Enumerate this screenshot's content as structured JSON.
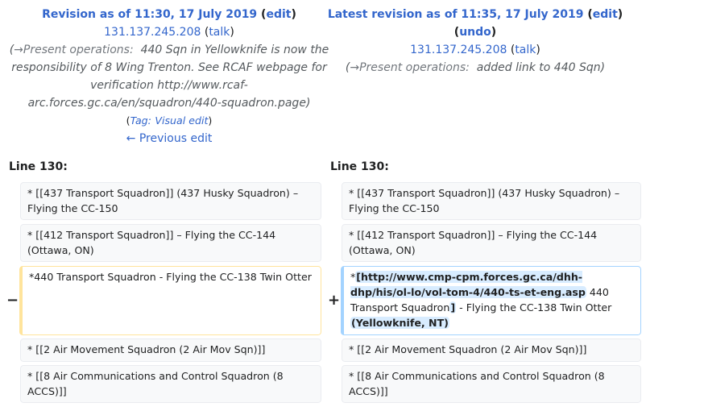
{
  "left_header": {
    "title_prefix": "Revision as of 11:30, 17 July 2019",
    "edit_link": "edit",
    "user_ip": "131.137.245.208",
    "talk_link": "talk",
    "autocomment": "→Present operations:",
    "summary": "440 Sqn in Yellowknife is now the responsibility of 8 Wing Trenton. See RCAF webpage for verification http://www.rcaf-arc.forces.gc.ca/en/squadron/440-squadron.page",
    "tag_label": "Tag:",
    "tag_value": "Visual edit",
    "prev_edit": "← Previous edit"
  },
  "right_header": {
    "title_prefix": "Latest revision as of 11:35, 17 July 2019",
    "edit_link": "edit",
    "undo_link": "undo",
    "user_ip": "131.137.245.208",
    "talk_link": "talk",
    "autocomment": "→Present operations:",
    "summary": "added link to 440 Sqn"
  },
  "line_labels": {
    "left": "Line 130:",
    "right": "Line 130:"
  },
  "rows": {
    "r1": "* [[437 Transport Squadron]] (437 Husky Squadron) – Flying the CC-150",
    "r2": "* [[412 Transport Squadron]] – Flying the CC-144 (Ottawa, ON)",
    "deleted": "*440 Transport Squadron - Flying the CC-138 Twin Otter",
    "added_star": "*",
    "added_ins1": "[http://www.cmp-cpm.forces.gc.ca/dhh-dhp/his/ol-lo/vol-tom-4/440-ts-et-eng.asp",
    "added_text1": " 440 Transport Squadron",
    "added_ins2": "]",
    "added_text2": " - Flying the CC-138 Twin Otter ",
    "added_ins3": "(Yellowknife, NT)",
    "r4": "* [[2 Air Movement Squadron (2 Air Mov Sqn)]]",
    "r5": "* [[8 Air Communications and Control Squadron (8 ACCS)]]"
  },
  "markers": {
    "minus": "−",
    "plus": "+"
  }
}
